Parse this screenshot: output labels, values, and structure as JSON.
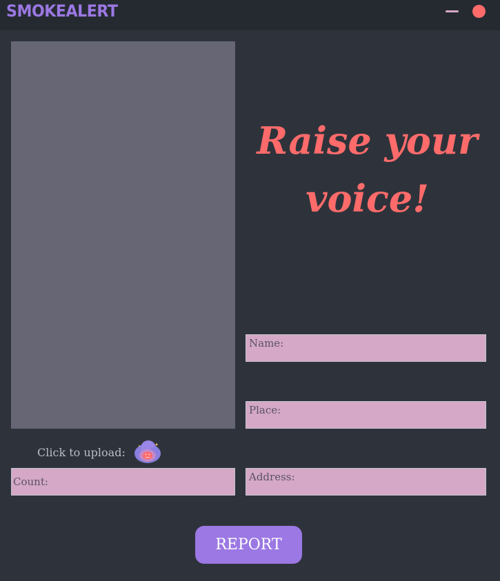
{
  "app": {
    "title": "SMOKEALERT"
  },
  "window_controls": {
    "minimize_icon": "minimize-icon",
    "close_icon": "close-icon"
  },
  "hero": {
    "line1": "Raise your",
    "line2": "voice!"
  },
  "form": {
    "name_label": "Name:",
    "place_label": "Place:",
    "address_label": "Address:",
    "count_label": "Count:",
    "upload_label": "Click to upload:",
    "upload_icon": "upload-cloud-icon",
    "report_label": "REPORT"
  },
  "colors": {
    "background": "#2e333b",
    "titlebar": "#252a31",
    "accent_purple": "#9b78e3",
    "accent_red": "#ff6b6b",
    "field_fill": "#d4a8c6",
    "image_placeholder": "#676675"
  }
}
